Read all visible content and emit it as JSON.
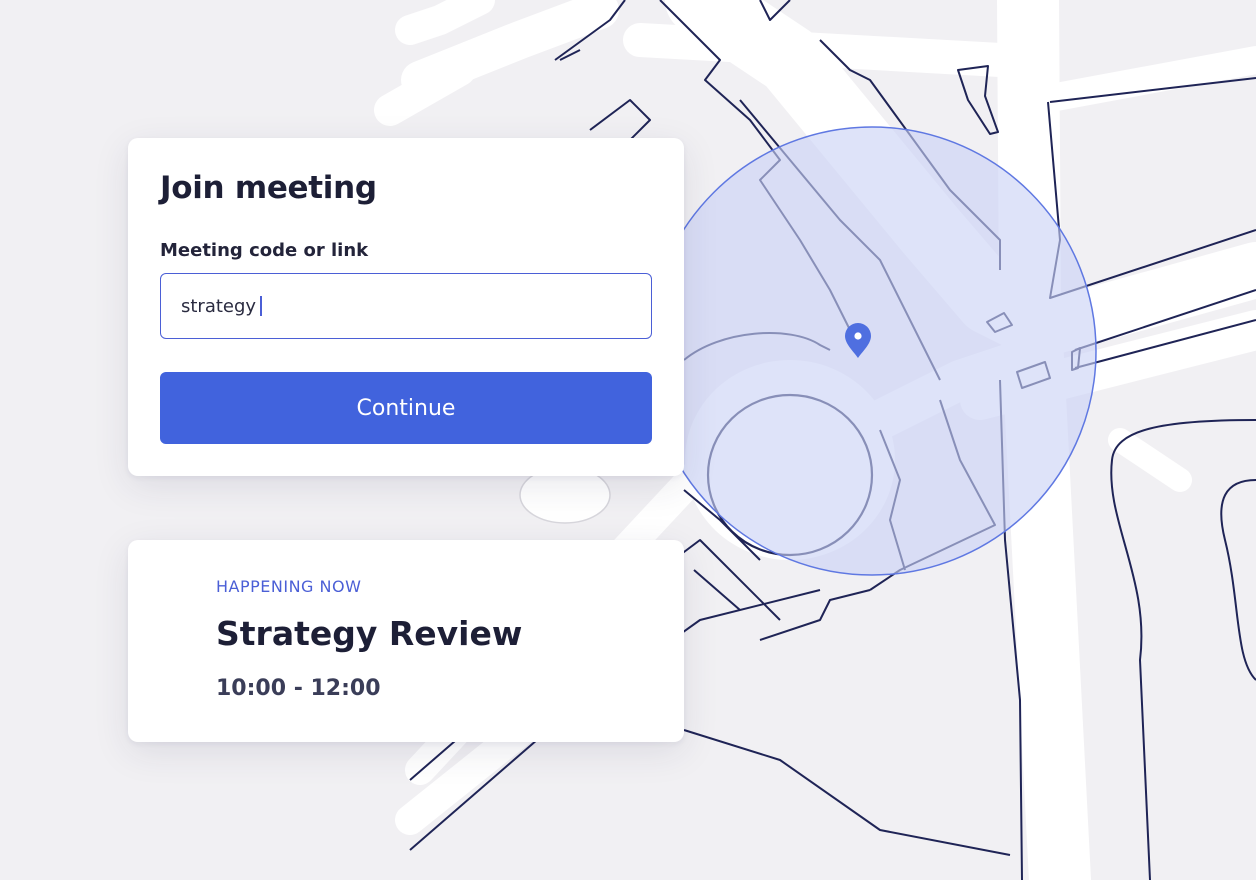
{
  "join": {
    "title": "Join meeting",
    "field_label": "Meeting code or link",
    "field_value": "strategy",
    "continue_label": "Continue"
  },
  "event": {
    "status": "HAPPENING NOW",
    "title": "Strategy Review",
    "time": "10:00 - 12:00"
  },
  "colors": {
    "accent": "#4163dd",
    "pin": "#4f6fe0",
    "radius_fill": "#d8dff8",
    "map_background": "#f1f0f3"
  },
  "icons": {
    "map_marker": "location-pin-icon"
  }
}
